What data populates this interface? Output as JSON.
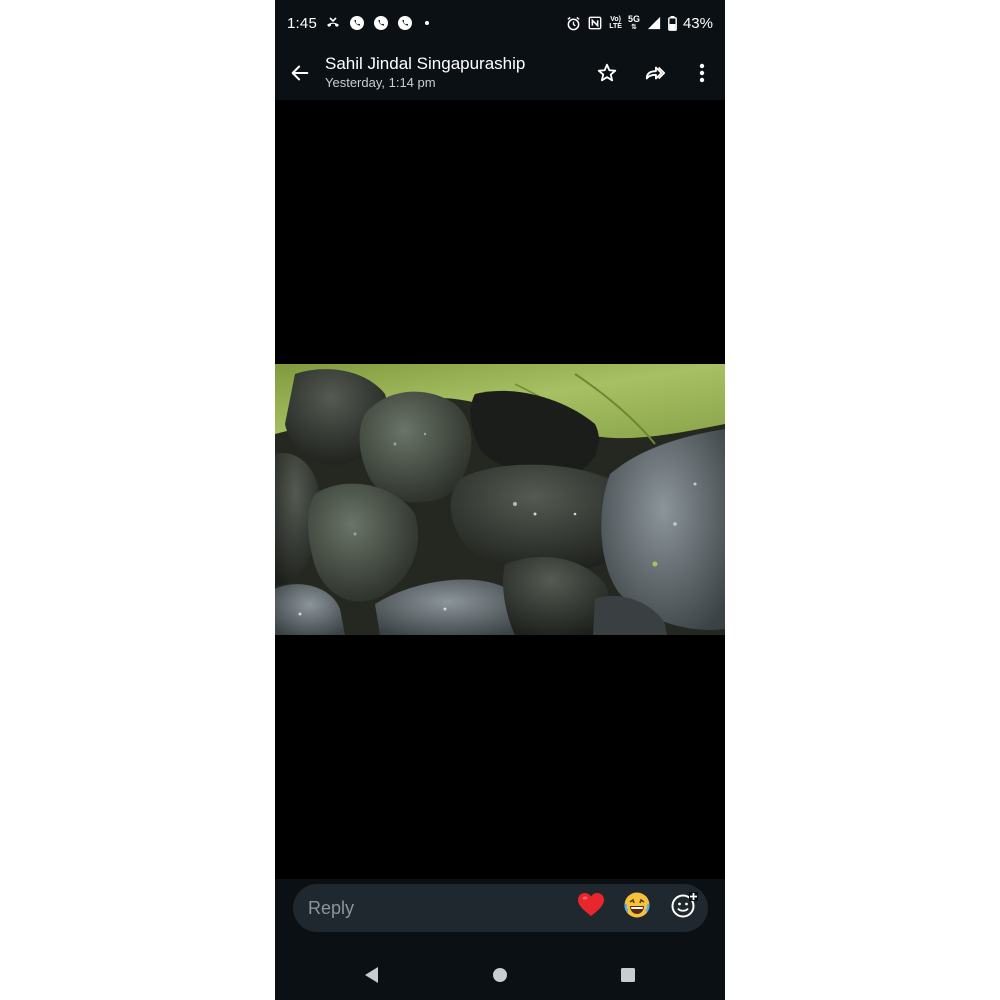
{
  "status_bar": {
    "time": "1:45",
    "network_label_top": "Vo)",
    "network_label_bottom": "LTE",
    "network_5g": "5G",
    "battery": "43%",
    "icons": [
      "missed-call-icon",
      "whatsapp-icon",
      "whatsapp-icon",
      "whatsapp-icon",
      "dot-icon",
      "alarm-icon",
      "nfc-icon",
      "volte-icon",
      "5g-icon",
      "signal-icon",
      "battery-icon"
    ]
  },
  "header": {
    "contact_name": "Sahil Jindal Singapuraship",
    "timestamp": "Yesterday, 1:14 pm",
    "actions": [
      "back-arrow-icon",
      "star-icon",
      "forward-icon",
      "more-vert-icon"
    ]
  },
  "media": {
    "description_icon": "photo-of-rocks"
  },
  "reply": {
    "placeholder": "Reply",
    "reactions": [
      "heart-emoji",
      "laughing-emoji",
      "add-emoji-icon"
    ]
  },
  "nav": {
    "buttons": [
      "back-triangle-icon",
      "home-circle-icon",
      "recents-square-icon"
    ]
  },
  "colors": {
    "bar_bg": "#0b1014",
    "reply_bg": "#1f282e",
    "placeholder": "#8a959c",
    "heart": "#e8262e"
  }
}
